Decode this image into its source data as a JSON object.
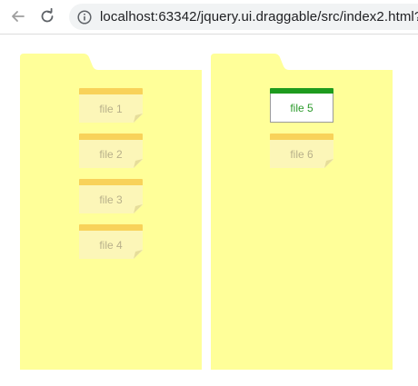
{
  "browser": {
    "url": "localhost:63342/jquery.ui.draggable/src/index2.html?"
  },
  "colors": {
    "folder": "#ffff99",
    "file_stripe": "#f8d25a",
    "file_body": "#fcf6b8",
    "active_stripe": "#1e9b1e",
    "active_text": "#2c9b2c"
  },
  "folders": [
    {
      "files": [
        {
          "label": "file 1"
        },
        {
          "label": "file 2"
        },
        {
          "label": "file 3"
        },
        {
          "label": "file 4"
        }
      ]
    },
    {
      "files": [
        {
          "label": "file 5",
          "active": true
        },
        {
          "label": "file 6"
        }
      ]
    }
  ]
}
